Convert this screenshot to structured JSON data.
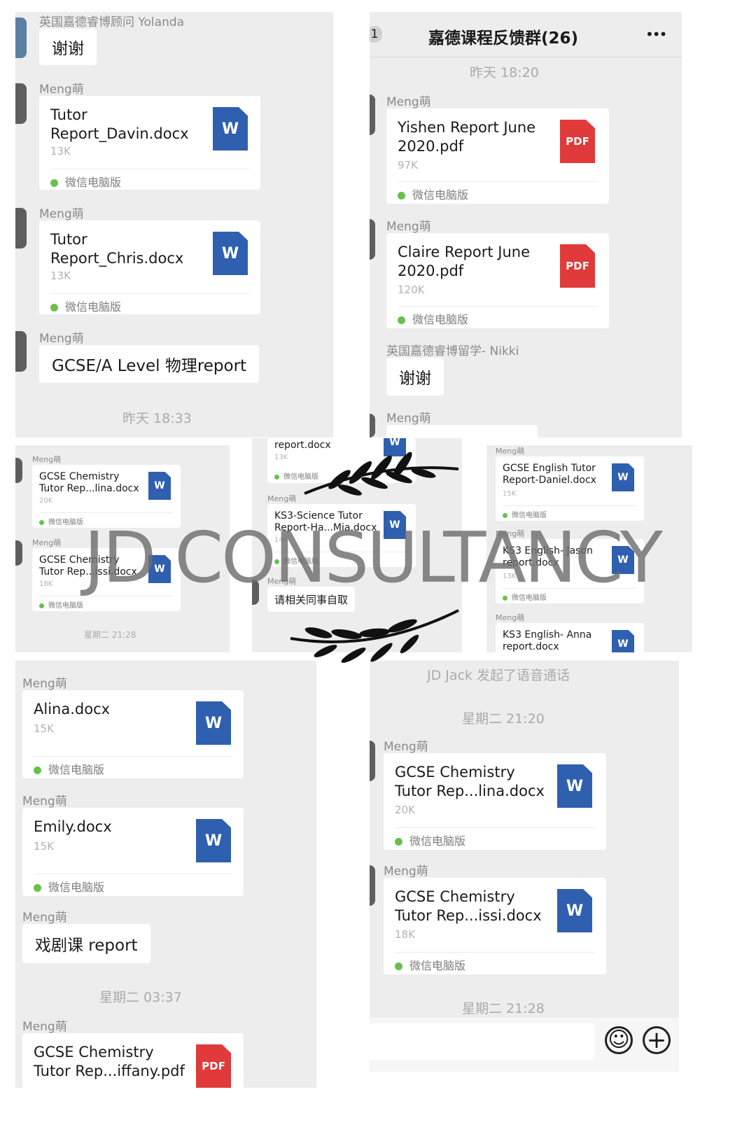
{
  "panel_a": {
    "header_sender": "英国嘉德睿博顾问 Yolanda",
    "thanks": "谢谢",
    "files": [
      {
        "sender": "Meng萌",
        "name_line1": "Tutor",
        "name_line2": "Report_Davin.docx",
        "size": "13K",
        "icon": "W",
        "source": "微信电脑版"
      },
      {
        "sender": "Meng萌",
        "name_line1": "Tutor",
        "name_line2": "Report_Chris.docx",
        "size": "13K",
        "icon": "W",
        "source": "微信电脑版"
      }
    ],
    "msg_sender": "Meng萌",
    "msg": "GCSE/A Level 物理report",
    "timestamp": "昨天 18:33"
  },
  "panel_b": {
    "back_count": "1",
    "title": "嘉德课程反馈群(26)",
    "more_icon": "•••",
    "timestamp": "昨天 18:20",
    "files": [
      {
        "sender": "Meng萌",
        "name_line1": "Yishen Report June",
        "name_line2": "2020.pdf",
        "size": "97K",
        "icon": "PDF",
        "source": "微信电脑版"
      },
      {
        "sender": "Meng萌",
        "name_line1": "Claire Report June",
        "name_line2": "2020.pdf",
        "size": "120K",
        "icon": "PDF",
        "source": "微信电脑版"
      }
    ],
    "nikki_sender": "英国嘉德睿博留学- Nikki",
    "nikki_msg": "谢谢",
    "last_sender": "Meng萌"
  },
  "panel_c": {
    "files": [
      {
        "sender": "Meng萌",
        "name_line1": "GCSE Chemistry",
        "name_line2": "Tutor Rep...lina.docx",
        "size": "20K",
        "icon": "W",
        "source": "微信电脑版"
      },
      {
        "sender": "Meng萌",
        "name_line1": "GCSE Chemistry",
        "name_line2": "Tutor Rep...issi.docx",
        "size": "18K",
        "icon": "W",
        "source": "微信电脑版"
      }
    ],
    "timestamp": "星期二 21:28"
  },
  "panel_d": {
    "top_name": "report.docx",
    "top_size": "13K",
    "top_icon": "W",
    "top_source": "微信电脑版",
    "file": {
      "sender": "Meng萌",
      "name_line1": "KS3-Science Tutor",
      "name_line2": "Report-Ha...Mia.docx",
      "size": "14K",
      "icon": "W",
      "source": "微信电脑版"
    },
    "msg_sender": "Meng萌",
    "msg": "请相关同事自取"
  },
  "panel_e": {
    "files": [
      {
        "sender": "Meng萌",
        "name_line1": "GCSE English Tutor",
        "name_line2": "Report-Daniel.docx",
        "size": "15K",
        "icon": "W",
        "source": "微信电脑版"
      },
      {
        "sender": "Meng萌",
        "name_line1": "KS3 English- Jason",
        "name_line2": "report.docx",
        "size": "13K",
        "icon": "W",
        "source": "微信电脑版"
      },
      {
        "sender": "Meng萌",
        "name_line1": "KS3 English- Anna",
        "name_line2": "report.docx",
        "size": "",
        "icon": "W",
        "source": ""
      }
    ]
  },
  "panel_f": {
    "files": [
      {
        "sender": "Meng萌",
        "name_line1": "Alina.docx",
        "name_line2": "",
        "size": "15K",
        "icon": "W",
        "source": "微信电脑版"
      },
      {
        "sender": "Meng萌",
        "name_line1": "Emily.docx",
        "name_line2": "",
        "size": "15K",
        "icon": "W",
        "source": "微信电脑版"
      }
    ],
    "msg_sender": "Meng萌",
    "msg": "戏剧课 report",
    "timestamp": "星期二 03:37",
    "last_sender": "Meng萌",
    "last_name_line1": "GCSE Chemistry",
    "last_name_line2": "Tutor Rep...iffany.pdf",
    "last_icon": "PDF"
  },
  "panel_g": {
    "call_notice": "JD Jack 发起了语音通话",
    "timestamp1": "星期二 21:20",
    "files": [
      {
        "sender": "Meng萌",
        "name_line1": "GCSE Chemistry",
        "name_line2": "Tutor Rep...lina.docx",
        "size": "20K",
        "icon": "W",
        "source": "微信电脑版"
      },
      {
        "sender": "Meng萌",
        "name_line1": "GCSE Chemistry",
        "name_line2": "Tutor Rep...issi.docx",
        "size": "18K",
        "icon": "W",
        "source": "微信电脑版"
      }
    ],
    "timestamp2": "星期二 21:28",
    "emoji_icon": "☺",
    "plus_icon": "+"
  },
  "watermark": "JD CONSULTANCY",
  "colors": {
    "chat_bg": "#ededed",
    "word_blue": "#2f5faf",
    "pdf_red": "#e03a3a",
    "wechat_green": "#69c04b"
  }
}
